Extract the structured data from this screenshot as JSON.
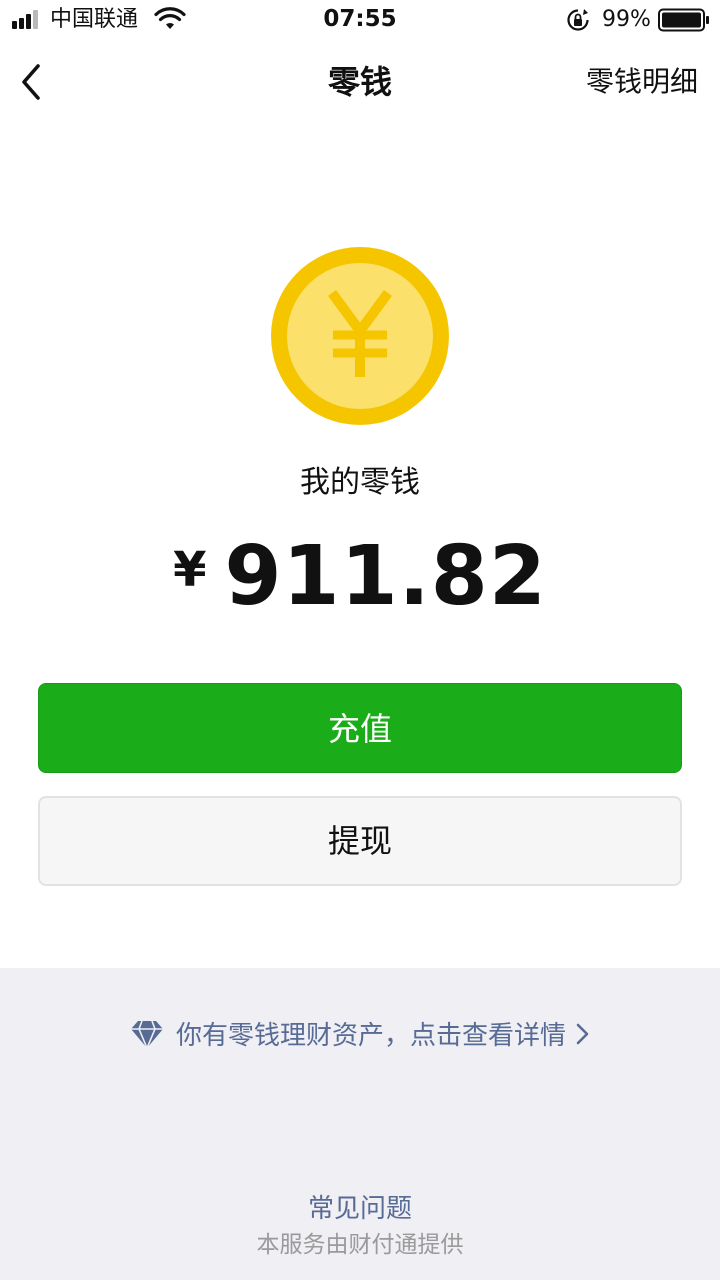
{
  "status_bar": {
    "carrier": "中国联通",
    "time": "07:55",
    "battery_percent": "99%",
    "icons": [
      "signal-icon",
      "wifi-icon",
      "rotation-lock-icon",
      "battery-icon"
    ]
  },
  "nav": {
    "back_icon": "chevron-left-icon",
    "title": "零钱",
    "detail_link": "零钱明细"
  },
  "wallet": {
    "coin_icon": "yuan-coin-icon",
    "label": "我的零钱",
    "currency_symbol": "¥",
    "amount": "911.82"
  },
  "actions": {
    "recharge_label": "充值",
    "withdraw_label": "提现"
  },
  "footer": {
    "wealth_icon": "diamond-icon",
    "wealth_link": "你有零钱理财资产，点击查看详情",
    "faq_link": "常见问题",
    "provider_text": "本服务由财付通提供"
  },
  "colors": {
    "primary_green": "#1aad19",
    "link_blue": "#576b95",
    "coin_gold": "#f5c600",
    "coin_inner": "#fbe06b",
    "footer_bg": "#efeff4"
  }
}
